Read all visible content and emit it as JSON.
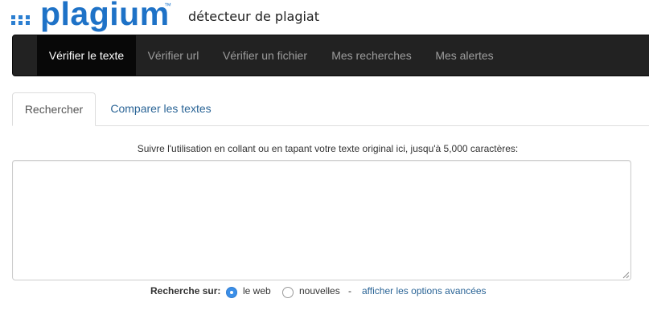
{
  "header": {
    "logo_text": "plagium",
    "logo_trademark": "™",
    "tagline": "détecteur de plagiat",
    "brand_color": "#1e72c7"
  },
  "navbar": {
    "background": "#222222",
    "items": [
      {
        "label": "Vérifier le texte",
        "active": true
      },
      {
        "label": "Vérifier url",
        "active": false
      },
      {
        "label": "Vérifier un fichier",
        "active": false
      },
      {
        "label": "Mes recherches",
        "active": false
      },
      {
        "label": "Mes alertes",
        "active": false
      }
    ]
  },
  "tabs": [
    {
      "label": "Rechercher",
      "active": true
    },
    {
      "label": "Comparer les textes",
      "active": false
    }
  ],
  "main": {
    "instruction": "Suivre l'utilisation en collant ou en tapant votre texte original ici, jusqu'à 5,000 caractères:",
    "textarea_value": ""
  },
  "search_options": {
    "label": "Recherche sur:",
    "options": [
      {
        "label": "le web",
        "checked": true
      },
      {
        "label": "nouvelles",
        "checked": false
      }
    ],
    "separator": "-",
    "advanced_link": "afficher les options avancées",
    "link_color": "#2a6496"
  }
}
